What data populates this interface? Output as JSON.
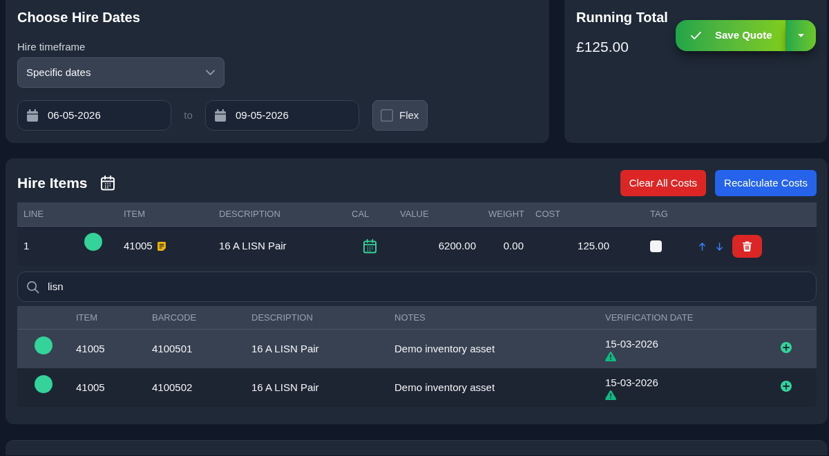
{
  "hire_dates": {
    "title": "Choose Hire Dates",
    "timeframe_label": "Hire timeframe",
    "timeframe": "Specific dates",
    "start_date": "06-05-2026",
    "separator": "to",
    "end_date": "09-05-2026",
    "flex": {
      "label": "Flex",
      "checked": false
    }
  },
  "running_total": {
    "title": "Running Total",
    "amount": "£125.00",
    "save_button": "Save Quote"
  },
  "hire_items": {
    "title": "Hire Items",
    "actions": [
      {
        "label": "Clear All Costs",
        "kind": "danger"
      },
      {
        "label": "Recalculate Costs",
        "kind": "primary"
      }
    ],
    "columns": [
      "LINE",
      "ITEM",
      "DESCRIPTION",
      "CAL",
      "VALUE",
      "WEIGHT",
      "COST",
      "TAG"
    ],
    "rows": [
      {
        "line": "1",
        "color": "#34d399",
        "item": "41005",
        "has_note": true,
        "description": "16 A LISN Pair",
        "value": "6200.00",
        "weight": "0.00",
        "cost": "125.00",
        "tagged": false
      }
    ],
    "search": {
      "value": "lisn"
    },
    "results": {
      "columns": [
        "ITEM",
        "BARCODE",
        "DESCRIPTION",
        "NOTES",
        "VERIFICATION DATE"
      ],
      "rows": [
        {
          "selected": true,
          "color": "#34d399",
          "item": "41005",
          "barcode": "4100501",
          "description": "16 A LISN Pair",
          "notes": "Demo inventory asset",
          "verification_date": "15-03-2026",
          "warning": true
        },
        {
          "selected": false,
          "color": "#34d399",
          "item": "41005",
          "barcode": "4100502",
          "description": "16 A LISN Pair",
          "notes": "Demo inventory asset",
          "verification_date": "15-03-2026",
          "warning": true
        }
      ]
    }
  }
}
